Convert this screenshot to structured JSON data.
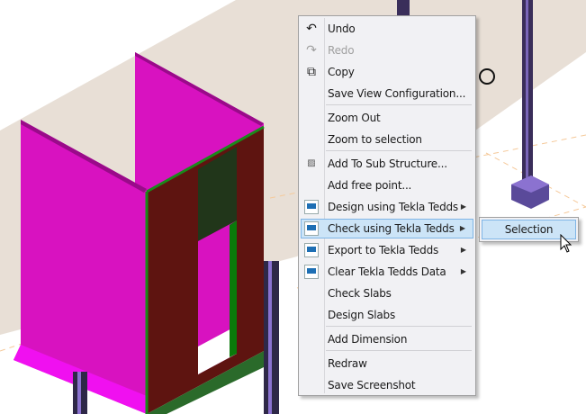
{
  "context_menu": {
    "items": [
      {
        "label": "Undo",
        "icon": "undo-icon",
        "enabled": true
      },
      {
        "label": "Redo",
        "icon": "redo-icon",
        "enabled": false
      },
      {
        "label": "Copy",
        "icon": "copy-icon",
        "enabled": true
      },
      {
        "label": "Save View Configuration...",
        "enabled": true
      },
      {
        "label": "Zoom Out",
        "enabled": true
      },
      {
        "label": "Zoom to selection",
        "enabled": true
      },
      {
        "label": "Add To Sub Structure...",
        "icon": "sub-structure-icon",
        "enabled": true
      },
      {
        "label": "Add free point...",
        "enabled": true
      },
      {
        "label": "Design using Tekla Tedds",
        "icon": "tekla-tedds-icon",
        "submenu": true
      },
      {
        "label": "Check using Tekla Tedds",
        "icon": "tekla-tedds-icon",
        "submenu": true,
        "highlighted": true
      },
      {
        "label": "Export to Tekla Tedds",
        "icon": "tekla-tedds-icon",
        "submenu": true
      },
      {
        "label": "Clear Tekla Tedds Data",
        "icon": "tekla-tedds-icon",
        "submenu": true
      },
      {
        "label": "Check Slabs"
      },
      {
        "label": "Design Slabs"
      },
      {
        "label": "Add Dimension"
      },
      {
        "label": "Redraw"
      },
      {
        "label": "Save Screenshot"
      }
    ]
  },
  "submenu": {
    "items": [
      {
        "label": "Selection",
        "highlighted": true
      }
    ]
  },
  "colors": {
    "slab": "#e8dfd6",
    "wall": "#d812c0",
    "front_wall": "#5e1410",
    "column": "#3a2e5a",
    "highlight": "#cce4f7"
  }
}
